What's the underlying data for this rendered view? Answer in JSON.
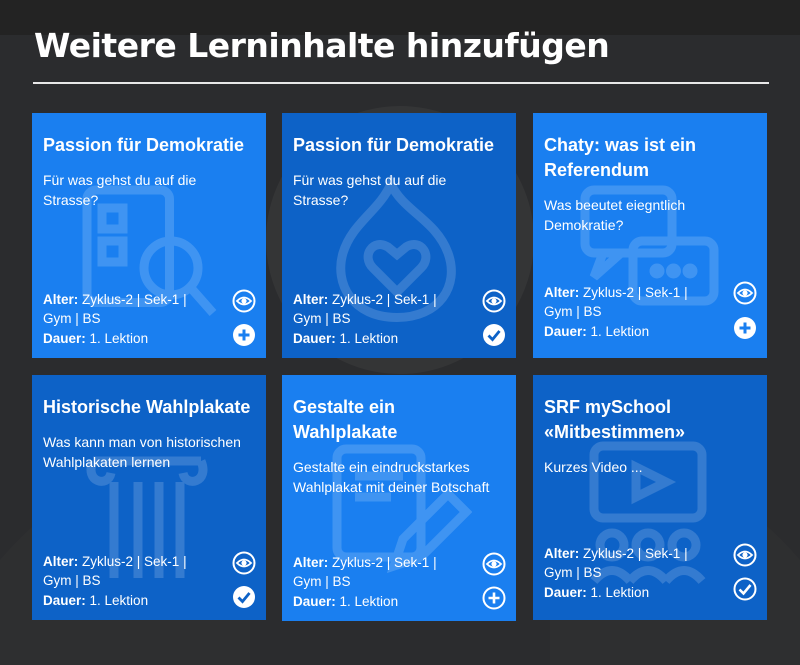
{
  "page": {
    "title": "Weitere Lerninhalte hinzufügen"
  },
  "labels": {
    "age": "Alter:",
    "duration": "Dauer:"
  },
  "cards": [
    {
      "title": "Passion für Demokratie",
      "description": "Für was gehst du auf die Strasse?",
      "age_value": "Zyklus-2 | Sek-1 | Gym | BS",
      "duration_value": "1. Lektion",
      "action": "add",
      "bg_icon": "search-document-icon"
    },
    {
      "title": "Passion für Demokratie",
      "description": "Für was gehst du auf die Strasse?",
      "age_value": "Zyklus-2 | Sek-1 | Gym | BS",
      "duration_value": "1. Lektion",
      "action": "added",
      "bg_icon": "flame-heart-icon"
    },
    {
      "title": "Chaty: was ist ein Referendum",
      "description": "Was beeutet eiegntlich Demokratie?",
      "age_value": "Zyklus-2 | Sek-1 | Gym | BS",
      "duration_value": "1. Lektion",
      "action": "add",
      "bg_icon": "chat-bubbles-icon"
    },
    {
      "title": "Historische Wahlplakate",
      "description": "Was kann man von historischen Wahlplakaten lernen",
      "age_value": "Zyklus-2 | Sek-1 | Gym | BS",
      "duration_value": "1. Lektion",
      "action": "added",
      "bg_icon": "column-icon"
    },
    {
      "title": "Gestalte ein Wahlplakate",
      "description": "Gestalte ein eindruckstarkes Wahlplakat mit deiner Botschaft",
      "age_value": "Zyklus-2 | Sek-1 | Gym | BS",
      "duration_value": "1. Lektion",
      "action": "add",
      "bg_icon": "pencil-document-icon"
    },
    {
      "title": "SRF mySchool «Mitbestimmen»",
      "description": "Kurzes Video ...",
      "age_value": "Zyklus-2 | Sek-1 | Gym | BS",
      "duration_value": "1. Lektion",
      "action": "added",
      "bg_icon": "video-people-icon"
    }
  ],
  "colors": {
    "card_light": "#1a7ff0",
    "card_dark": "#0d62c7",
    "background": "#2b2c2e",
    "text": "#ffffff"
  }
}
